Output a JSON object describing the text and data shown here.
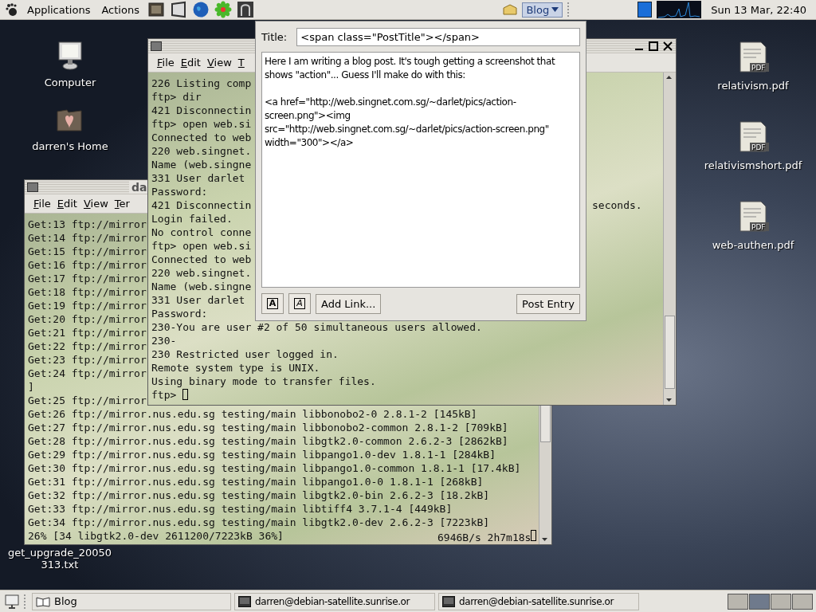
{
  "top_panel": {
    "menus": [
      "Applications",
      "Actions"
    ],
    "blog_button": "Blog",
    "clock": "Sun 13 Mar, 22:40"
  },
  "desktop_icons": [
    {
      "kind": "computer",
      "lines": [
        "Computer"
      ]
    },
    {
      "kind": "home",
      "lines": [
        "darren's Home"
      ]
    },
    {
      "kind": "pdf",
      "badge": "PDF",
      "lines": [
        "relativism.pdf"
      ]
    },
    {
      "kind": "pdf",
      "badge": "PDF",
      "lines": [
        "relativismshort.pdf"
      ]
    },
    {
      "kind": "pdf",
      "badge": "PDF",
      "lines": [
        "web-authen.pdf"
      ]
    },
    {
      "kind": "text",
      "lines": [
        "get_upgrade_20050",
        "313.txt"
      ]
    }
  ],
  "back_terminal": {
    "title": "da",
    "menu": [
      "File",
      "Edit",
      "View",
      "Ter"
    ],
    "lines": [
      {
        "text": "Get:13 ftp://mirror"
      },
      {
        "text": "Get:14 ftp://mirror"
      },
      {
        "text": "Get:15 ftp://mirror"
      },
      {
        "text": "Get:16 ftp://mirror"
      },
      {
        "text": "Get:17 ftp://mirror"
      },
      {
        "text": "Get:18 ftp://mirror"
      },
      {
        "text": "Get:19 ftp://mirror"
      },
      {
        "text": "Get:20 ftp://mirror"
      },
      {
        "text": "Get:21 ftp://mirror"
      },
      {
        "text": "Get:22 ftp://mirror"
      },
      {
        "text": "Get:23 ftp://mirror"
      },
      {
        "text": "Get:24 ftp://mirror"
      },
      {
        "text": "]"
      },
      {
        "text": "Get:25 ftp://mirror"
      },
      {
        "text": "Get:26 ftp://mirror.nus.edu.sg testing/main libbonobo2-0 2.8.1-2 [145kB]"
      },
      {
        "text": "Get:27 ftp://mirror.nus.edu.sg testing/main libbonobo2-common 2.8.1-2 [709kB]"
      },
      {
        "text": "Get:28 ftp://mirror.nus.edu.sg testing/main libgtk2.0-common 2.6.2-3 [2862kB]"
      },
      {
        "text": "Get:29 ftp://mirror.nus.edu.sg testing/main libpango1.0-dev 1.8.1-1 [284kB]"
      },
      {
        "text": "Get:30 ftp://mirror.nus.edu.sg testing/main libpango1.0-common 1.8.1-1 [17.4kB]"
      },
      {
        "text": "Get:31 ftp://mirror.nus.edu.sg testing/main libpango1.0-0 1.8.1-1 [268kB]"
      },
      {
        "text": "Get:32 ftp://mirror.nus.edu.sg testing/main libgtk2.0-bin 2.6.2-3 [18.2kB]"
      },
      {
        "text": "Get:33 ftp://mirror.nus.edu.sg testing/main libtiff4 3.7.1-4 [449kB]"
      },
      {
        "text": "Get:34 ftp://mirror.nus.edu.sg testing/main libgtk2.0-dev 2.6.2-3 [7223kB]"
      },
      {
        "text": "26% [34 libgtk2.0-dev 2611200/7223kB 36%]",
        "tail": "6946B/s 2h7m18s",
        "cursor": true
      }
    ]
  },
  "front_terminal": {
    "menu": [
      "File",
      "Edit",
      "View",
      "T"
    ],
    "lines": [
      {
        "text": "226 Listing comp"
      },
      {
        "text": "ftp> dir"
      },
      {
        "text": "421 Disconnectin"
      },
      {
        "text": "ftp> open web.si"
      },
      {
        "text": "Connected to web"
      },
      {
        "text": "220 web.singnet."
      },
      {
        "text": "Name (web.singne"
      },
      {
        "text": "331 User darlet"
      },
      {
        "text": "Password:"
      },
      {
        "text": "421 Disconnectin",
        "tail": "seconds."
      },
      {
        "text": "Login failed."
      },
      {
        "text": "No control conne"
      },
      {
        "text": "ftp> open web.si"
      },
      {
        "text": "Connected to web"
      },
      {
        "text": "220 web.singnet."
      },
      {
        "text": "Name (web.singne"
      },
      {
        "text": "331 User darlet"
      },
      {
        "text": "Password:"
      },
      {
        "text": "230-You are user #2 of 50 simultaneous users allowed."
      },
      {
        "text": "230-"
      },
      {
        "text": "230 Restricted user logged in."
      },
      {
        "text": "Remote system type is UNIX."
      },
      {
        "text": "Using binary mode to transfer files."
      },
      {
        "text": "ftp>",
        "cursor": true
      }
    ]
  },
  "blog_dialog": {
    "title_label": "Title:",
    "title_value": "<span class=\"PostTitle\"></span>",
    "body": "Here I am writing a blog post. It's tough getting a screenshot that shows \"action\"... Guess I'll make do with this:\n\n<a href=\"http://web.singnet.com.sg/~darlet/pics/action-screen.png\"><img src=\"http://web.singnet.com.sg/~darlet/pics/action-screen.png\" width=\"300\"></a>",
    "buttons": [
      {
        "kind": "bold",
        "label": "A"
      },
      {
        "kind": "italic",
        "label": "A"
      },
      {
        "kind": "text",
        "label": "Add Link..."
      },
      {
        "kind": "primary",
        "label": "Post Entry"
      }
    ]
  },
  "bottom_panel": {
    "tasks": [
      {
        "kind": "blog",
        "label": "Blog"
      },
      {
        "kind": "terminal",
        "label": "darren@debian-satellite.sunrise.or"
      },
      {
        "kind": "terminal",
        "label": "darren@debian-satellite.sunrise.or"
      }
    ],
    "workspaces": [
      {
        "selected": false
      },
      {
        "selected": true
      },
      {
        "selected": false
      },
      {
        "selected": false
      }
    ]
  }
}
